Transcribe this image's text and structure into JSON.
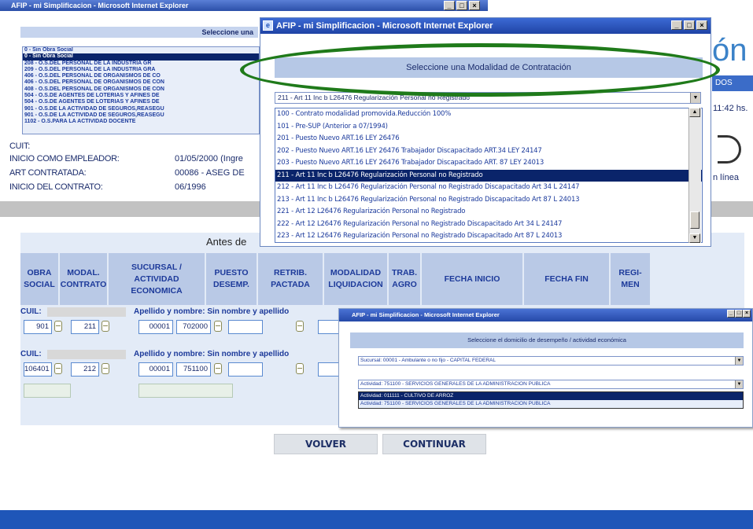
{
  "bg_window": {
    "title": "AFIP - mi Simplificacion - Microsoft Internet Explorer",
    "os_header": "Seleccione una",
    "os_list": [
      "0 - Sin Obra Social",
      "0 - Sin Obra Social",
      "208 - O.S.DEL PERSONAL DE LA INDUSTRIA GR",
      "209 - O.S.DEL PERSONAL DE LA INDUSTRIA GRA",
      "406 - O.S.DEL PERSONAL DE ORGANISMOS DE CO",
      "406 - O.S.DEL PERSONAL DE ORGANISMOS DE CON",
      "408 - O.S.DEL PERSONAL DE ORGANISMOS DE CON",
      "504 - O.S.DE AGENTES DE LOTERIAS Y AFINES DE",
      "504 - O.S.DE AGENTES DE LOTERIAS Y AFINES DE",
      "901 - O.S.DE LA ACTIVIDAD DE SEGUROS,REASEGU",
      "901 - O.S.DE LA ACTIVIDAD DE SEGUROS,REASEGU",
      "1102 - O.S.PARA LA ACTIVIDAD DOCENTE"
    ],
    "logo_text": "ón",
    "dos_text": "DOS",
    "time": "11:42 hs.",
    "en_linea": "n línea"
  },
  "info": {
    "cuit_label": "CUIT:",
    "inicio_empleador_label": "INICIO COMO EMPLEADOR:",
    "inicio_empleador_value": "01/05/2000 (Ingre",
    "art_label": "ART CONTRATADA:",
    "art_value": "00086 - ASEG DE",
    "inicio_contrato_label": "INICIO DEL CONTRATO:",
    "inicio_contrato_value": "06/1996"
  },
  "table": {
    "caption": "Antes de",
    "headers": [
      "OBRA SOCIAL",
      "MODAL. CONTRATO",
      "SUCURSAL / ACTIVIDAD ECONOMICA",
      "PUESTO DESEMP.",
      "RETRIB. PACTADA",
      "MODALIDAD LIQUIDACION",
      "TRAB. AGRO",
      "FECHA INICIO",
      "FECHA FIN",
      "REGI-MEN"
    ],
    "rows": [
      {
        "cuil": "CUIL:",
        "nombre": "Apellido y nombre: Sin nombre y apellido",
        "obra_social": "901",
        "modal": "211",
        "sucursal": "00001",
        "actividad": "702000"
      },
      {
        "cuil": "CUIL:",
        "nombre": "Apellido y nombre: Sin nombre y apellido",
        "obra_social": "106401",
        "modal": "212",
        "sucursal": "00001",
        "actividad": "751100"
      }
    ]
  },
  "buttons": {
    "volver": "VOLVER",
    "continuar": "CONTINUAR"
  },
  "popup_modalidad": {
    "title": "AFIP - mi Simplificacion - Microsoft Internet Explorer",
    "heading": "Seleccione una Modalidad de Contratación",
    "selected": "211 - Art 11 Inc b L26476 Regularización Personal no Registrado",
    "options": [
      "100 - Contrato modalidad promovida.Reducción 100%",
      "101 - Pre-SUP (Anterior a 07/1994)",
      "201 - Puesto Nuevo ART.16 LEY 26476",
      "202 - Puesto Nuevo ART.16 LEY 26476 Trabajador Discapacitado ART.34 LEY 24147",
      "203 - Puesto Nuevo ART.16 LEY 26476 Trabajador Discapacitado ART. 87 LEY 24013",
      "211 - Art 11 Inc b L26476 Regularización Personal no Registrado",
      "212 - Art 11 Inc b L26476 Regularización Personal no Registrado Discapacitado Art 34 L 24147",
      "213 - Art 11 Inc b L26476 Regularización Personal no Registrado Discapacitado Art 87 L 24013",
      "221 - Art 12 L26476 Regularización Personal no Registrado",
      "222 - Art 12 L26476 Regularización Personal no Registrado Discapacitado Art 34 L 24147",
      "223 - Art 12 L26476 Regularización Personal no Registrado Discapacitado Art 87 L 24013"
    ],
    "selected_index": 5,
    "highlight_color": "#1f7a1a"
  },
  "popup_domicilio": {
    "title": "AFIP - mi Simplificacion - Microsoft Internet Explorer",
    "heading": "Seleccione el domicilio de desempeño / actividad económica",
    "sucursal": "Sucursal: 00001 - Ambulante o no fijo - CAPITAL FEDERAL",
    "actividad": "Actividad: 751100 - SERVICIOS GENERALES DE LA ADMINISTRACION PUBLICA",
    "list": [
      "Actividad: 011111 - CULTIVO DE ARROZ",
      "Actividad: 751100 - SERVICIOS GENERALES DE LA ADMINISTRACION PUBLICA"
    ]
  }
}
